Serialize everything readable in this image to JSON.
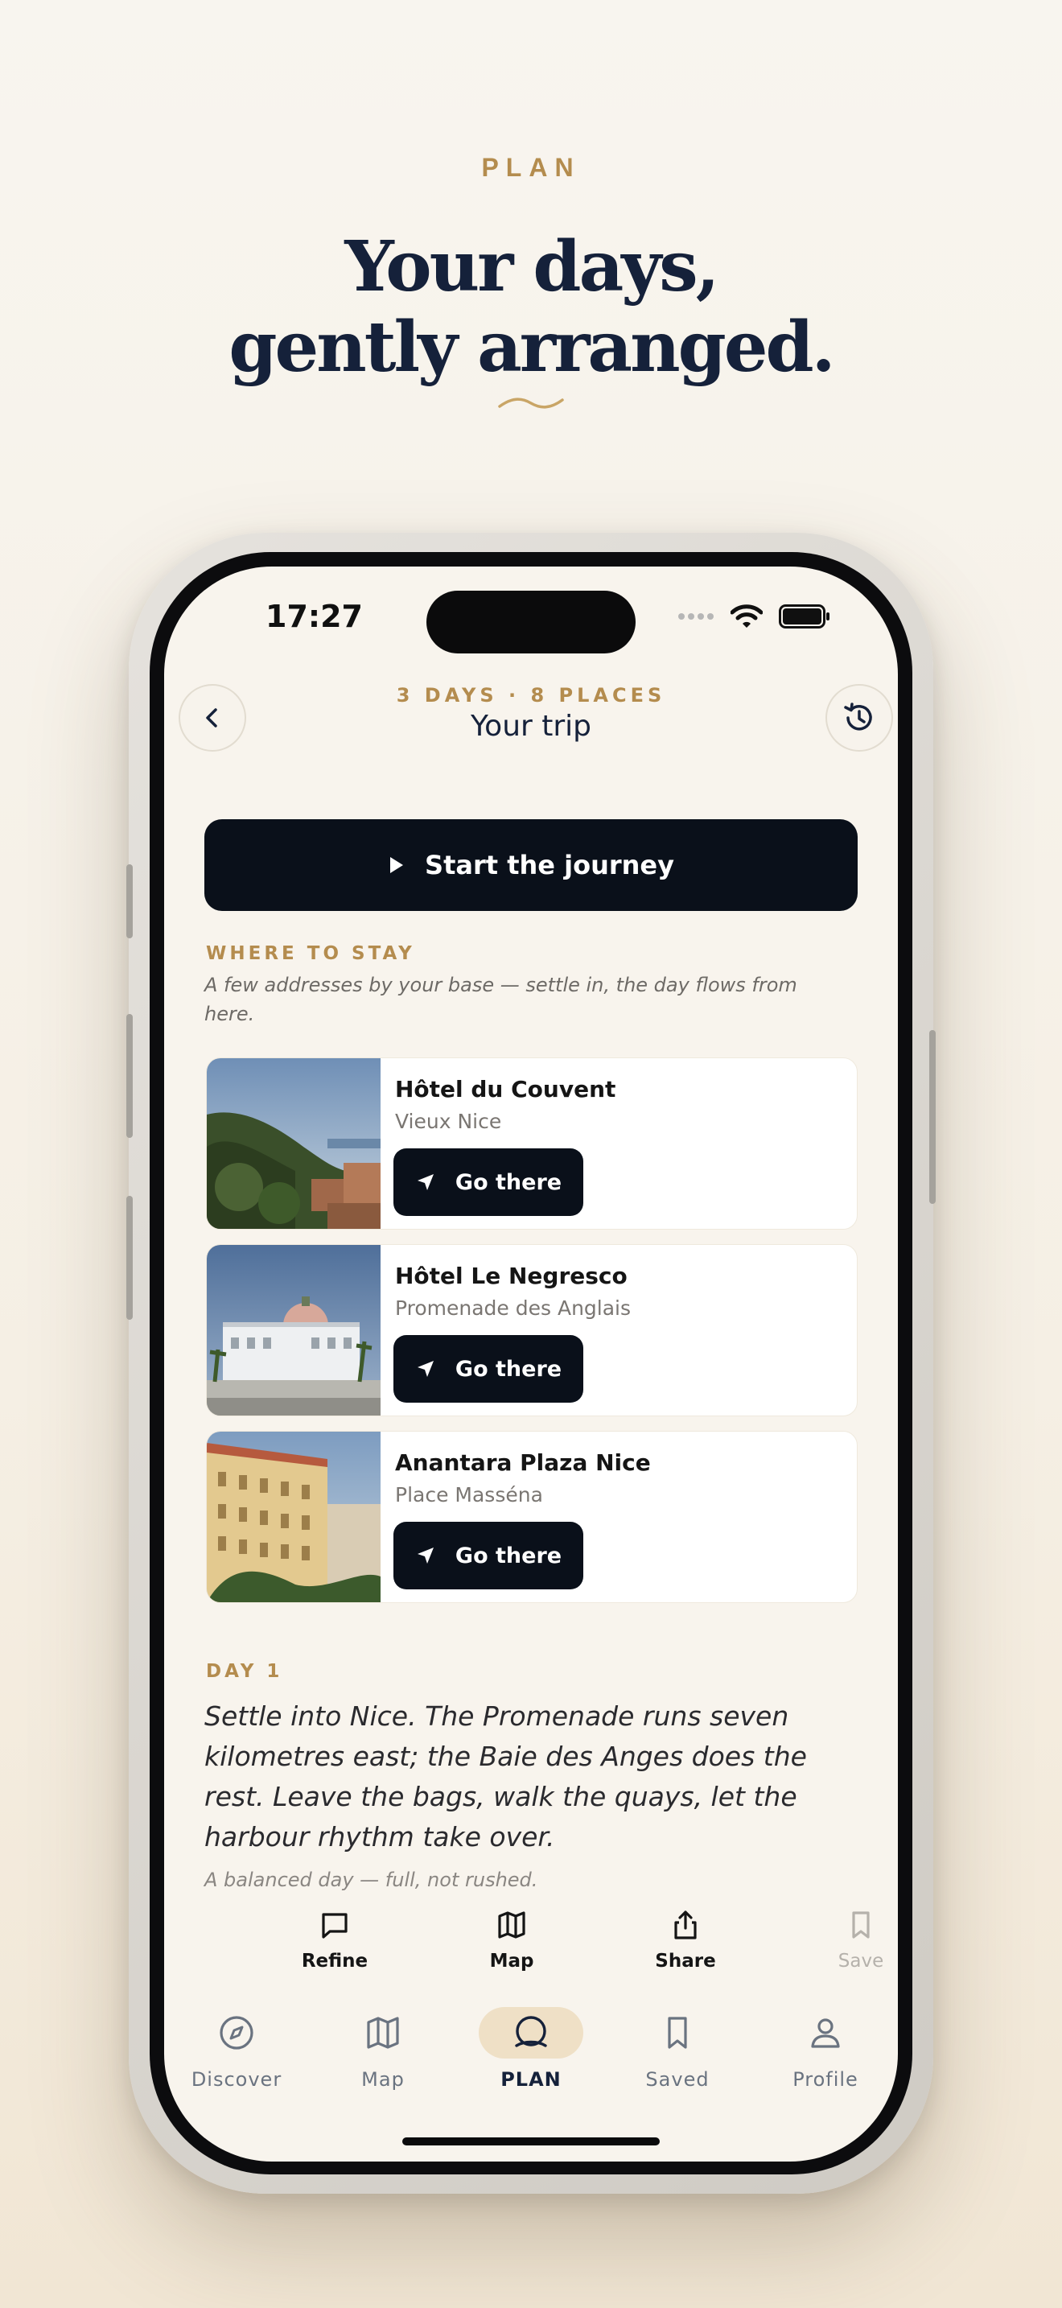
{
  "hero": {
    "eyebrow": "PLAN",
    "title_line1": "Your days,",
    "title_line2": "gently arranged."
  },
  "status_bar": {
    "time": "17:27"
  },
  "header": {
    "meta": "3 DAYS · 8 PLACES",
    "title": "Your trip",
    "back_icon": "chevron-left-icon",
    "history_icon": "history-icon"
  },
  "start_button": {
    "label": "Start the journey"
  },
  "stay": {
    "label": "WHERE TO STAY",
    "subtitle": "A few addresses by your base — settle in, the day flows from here.",
    "hotels": [
      {
        "name": "Hôtel du Couvent",
        "area": "Vieux Nice",
        "button": "Go there"
      },
      {
        "name": "Hôtel Le Negresco",
        "area": "Promenade des Anglais",
        "button": "Go there"
      },
      {
        "name": "Anantara Plaza Nice",
        "area": "Place Masséna",
        "button": "Go there"
      }
    ]
  },
  "day1": {
    "label": "DAY 1",
    "text": "Settle into Nice. The Promenade runs seven kilometres east; the Baie des Anges does the rest. Leave the bags, walk the quays, let the harbour rhythm take over.",
    "note": "A balanced day — full, not rushed."
  },
  "actions": [
    {
      "label": "Refine",
      "icon": "chat-icon"
    },
    {
      "label": "Map",
      "icon": "map-icon"
    },
    {
      "label": "Share",
      "icon": "share-icon"
    },
    {
      "label": "Save",
      "icon": "bookmark-icon"
    }
  ],
  "tabs": [
    {
      "label": "Discover",
      "icon": "compass-icon"
    },
    {
      "label": "Map",
      "icon": "map-icon"
    },
    {
      "label": "PLAN",
      "icon": "plan-icon"
    },
    {
      "label": "Saved",
      "icon": "bookmark-icon"
    },
    {
      "label": "Profile",
      "icon": "user-icon"
    }
  ],
  "colors": {
    "accent_gold": "#b48c4e",
    "navy": "#15213a",
    "button_dark": "#0a101a",
    "screen_bg": "#f8f4ed"
  }
}
